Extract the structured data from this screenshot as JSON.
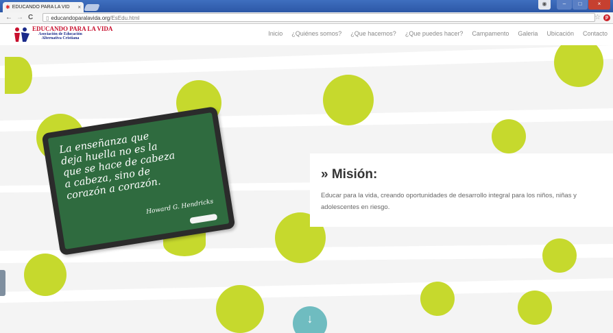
{
  "browser": {
    "tab_title": "EDUCANDO PARA LA VID",
    "tab_close": "×",
    "address_domain": "educandoparalavida.org",
    "address_path": "/EsEdu.html"
  },
  "site": {
    "logo_title": "EDUCANDO PARA LA VIDA",
    "logo_subtitle_1": "Asociación de Educación",
    "logo_subtitle_2": "Alternativa Cristiana"
  },
  "nav": {
    "items": [
      "Inicio",
      "¿Quiénes somos?",
      "¿Que hacemos?",
      "¿Que puedes hacer?",
      "Campamento",
      "Galeria",
      "Ubicación",
      "Contacto"
    ]
  },
  "chalkboard": {
    "quote_lines": [
      "La enseñanza que",
      "deja huella no es la",
      "que se hace de cabeza",
      "a cabeza, sino de",
      "corazón a corazón."
    ],
    "author": "Howard G. Hendricks"
  },
  "mision": {
    "heading": "» Misión:",
    "body": "Educar para la vida, creando oportunidades de desarrollo integral para los niños, niñas y adolescentes en riesgo."
  },
  "colors": {
    "accent_green": "#c6d92d",
    "chalkboard_green": "#2f6b3f",
    "logo_red": "#c8102e",
    "teal_button": "#6fbcc0"
  },
  "icons": {
    "scroll_down": "↓",
    "reload": "C",
    "back": "←",
    "forward": "→",
    "bookmark": "☆"
  }
}
